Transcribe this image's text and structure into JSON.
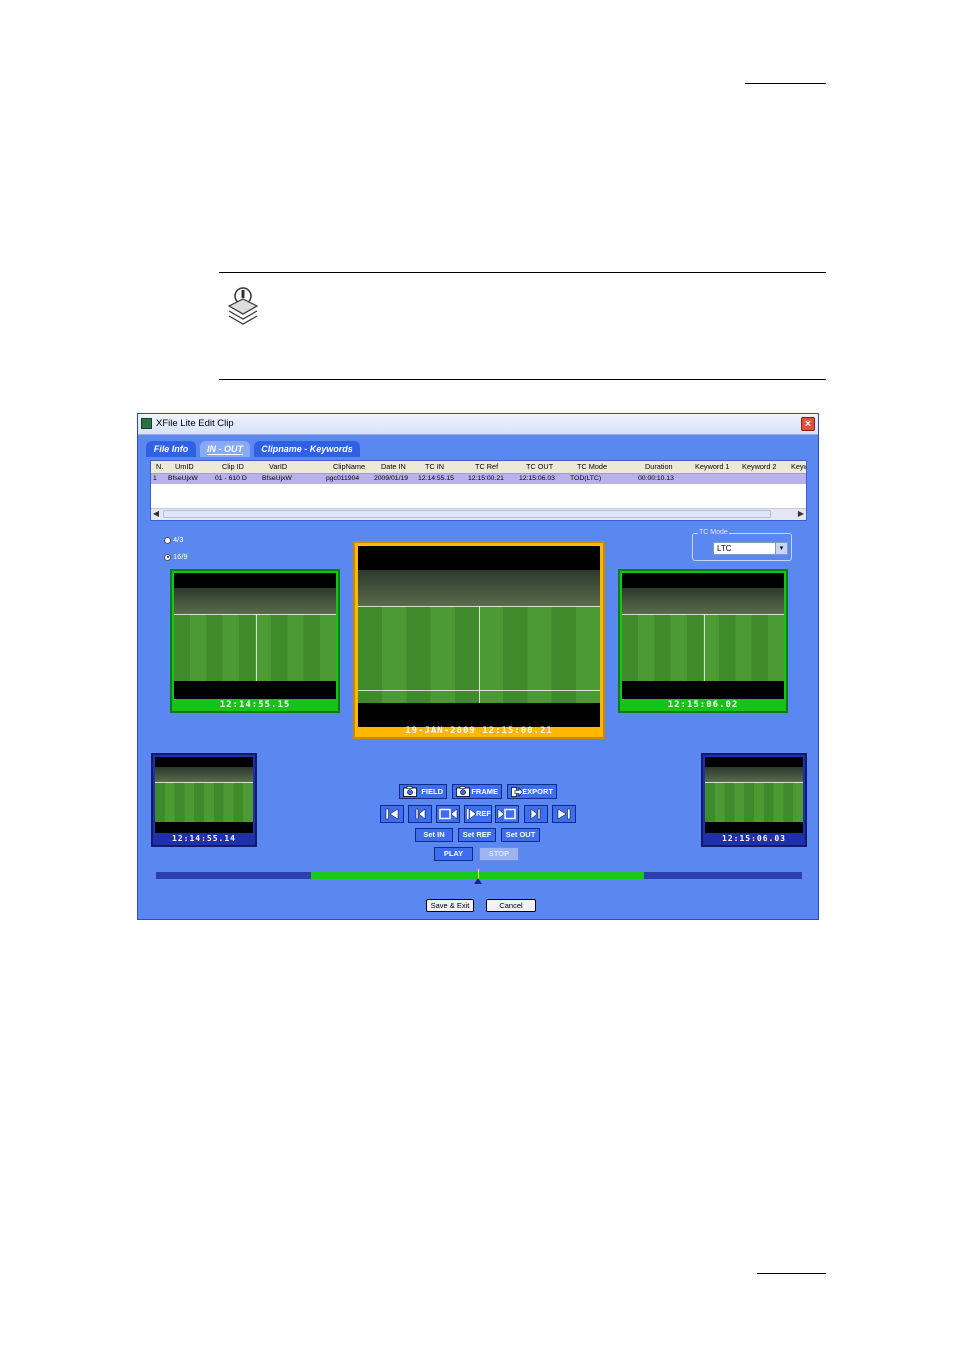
{
  "window": {
    "title": "XFile Lite Edit Clip",
    "close_glyph": "×"
  },
  "tabs": [
    {
      "label": "File Info"
    },
    {
      "label": "IN - OUT"
    },
    {
      "label": "Clipname - Keywords"
    }
  ],
  "grid": {
    "columns": [
      "N.",
      "UmID",
      "Clip ID",
      "VarID",
      "ClipName",
      "Date IN",
      "TC IN",
      "TC Ref",
      "TC OUT",
      "TC Mode",
      "Duration",
      "Keyword 1",
      "Keyword 2",
      "Keyw"
    ],
    "rows": [
      [
        "1",
        "BfseUjxW",
        "01 - 610 D",
        "BfseUjxW",
        "pgc011904",
        "2009/01/19",
        "12:14:55.15",
        "12:15:00.21",
        "12:15:06.03",
        "TOD(LTC)",
        "00:00:10.13",
        "",
        "",
        ""
      ]
    ]
  },
  "aspect": {
    "opt1": "4/3",
    "opt2": "16/9",
    "selected": "16/9"
  },
  "tc_mode": {
    "label": "TC Mode",
    "value": "LTC",
    "dropdown_glyph": "▾"
  },
  "frames": {
    "in_tc": "12:14:55.15",
    "ref_tc": "19-JAN-2009 12:15:00.21",
    "out_tc": "12:15:06.02",
    "prev_tc": "12:14:55.14",
    "next_tc": "12:15:06.03"
  },
  "buttons": {
    "field": "FIELD",
    "frame": "FRAME",
    "export": "EXPORT",
    "ref": "REF",
    "set_in": "Set IN",
    "set_ref": "Set REF",
    "set_out": "Set OUT",
    "play": "PLAY",
    "stop": "STOP",
    "save_exit": "Save & Exit",
    "cancel": "Cancel"
  },
  "timeline": {
    "in_fraction": 0.24,
    "out_fraction": 0.755,
    "cursor_fraction": 0.499
  },
  "icons": {
    "note": "note-icon",
    "camera": "camera-icon",
    "export": "export-arrow-icon"
  }
}
